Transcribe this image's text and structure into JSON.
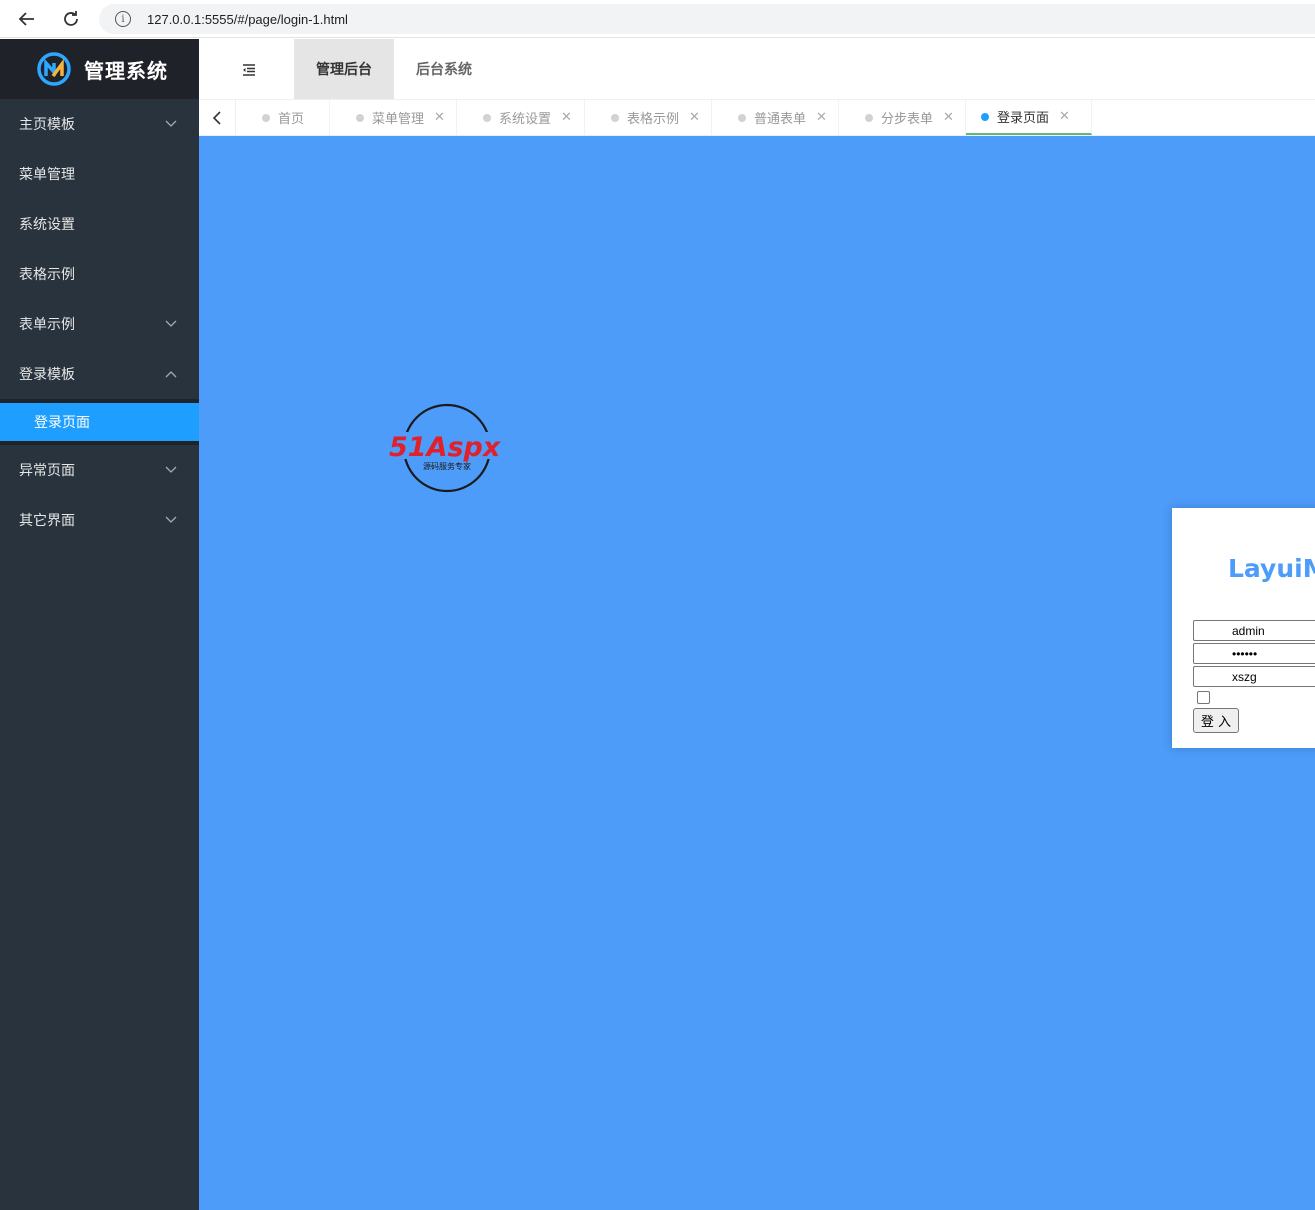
{
  "browser": {
    "url": "127.0.0.1:5555/#/page/login-1.html"
  },
  "sidebar": {
    "logo_text": "管理系统",
    "items": [
      {
        "label": "主页模板",
        "chevron": "down"
      },
      {
        "label": "菜单管理"
      },
      {
        "label": "系统设置"
      },
      {
        "label": "表格示例"
      },
      {
        "label": "表单示例",
        "chevron": "down"
      },
      {
        "label": "登录模板",
        "chevron": "up"
      },
      {
        "label": "异常页面",
        "chevron": "down"
      },
      {
        "label": "其它界面",
        "chevron": "down"
      }
    ],
    "sub_items": [
      {
        "label": "登录页面"
      }
    ]
  },
  "header": {
    "tabs": [
      {
        "label": "管理后台",
        "active": true
      },
      {
        "label": "后台系统",
        "active": false
      }
    ]
  },
  "page_tabs": [
    {
      "label": "首页",
      "closable": false
    },
    {
      "label": "菜单管理",
      "closable": true
    },
    {
      "label": "系统设置",
      "closable": true
    },
    {
      "label": "表格示例",
      "closable": true
    },
    {
      "label": "普通表单",
      "closable": true
    },
    {
      "label": "分步表单",
      "closable": true
    },
    {
      "label": "登录页面",
      "closable": true,
      "active": true
    }
  ],
  "content": {
    "watermark": {
      "brand": "51Aspx",
      "slogan": "源码服务专家"
    },
    "login": {
      "title": "LayuiMini",
      "username": "admin",
      "password": "123456",
      "captcha": "xszg",
      "submit_label": "登 入"
    }
  },
  "colors": {
    "sidebar_bg": "#28333e",
    "logo_bg": "#20222a",
    "accent": "#1e9fff",
    "content_bg": "#4d9cfa",
    "active_tab_line": "#5fb878"
  }
}
